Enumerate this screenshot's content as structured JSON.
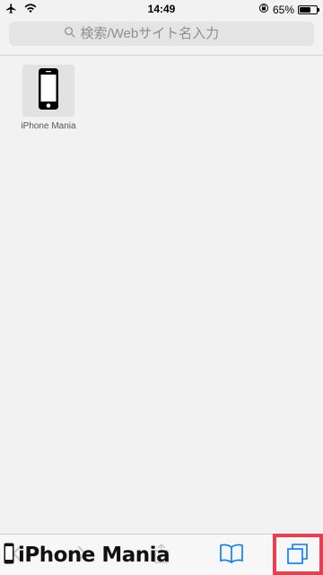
{
  "status_bar": {
    "time": "14:49",
    "battery_percent_label": "65%",
    "battery_level": 0.65,
    "icons": [
      "airplane-icon",
      "wifi-icon",
      "moon-icon",
      "orientation-lock-icon",
      "battery-icon"
    ]
  },
  "search": {
    "placeholder": "検索/Webサイト名入力"
  },
  "favorites": [
    {
      "label": "iPhone Mania",
      "icon": "phone-icon"
    }
  ],
  "toolbar": {
    "buttons": [
      "back-icon",
      "forward-icon",
      "share-icon",
      "bookmarks-icon",
      "tabs-icon"
    ]
  },
  "watermark": {
    "text": "iPhone Mania"
  },
  "colors": {
    "accent": "#007aff",
    "highlight": "#e8404e",
    "background": "#f2f2f2"
  }
}
